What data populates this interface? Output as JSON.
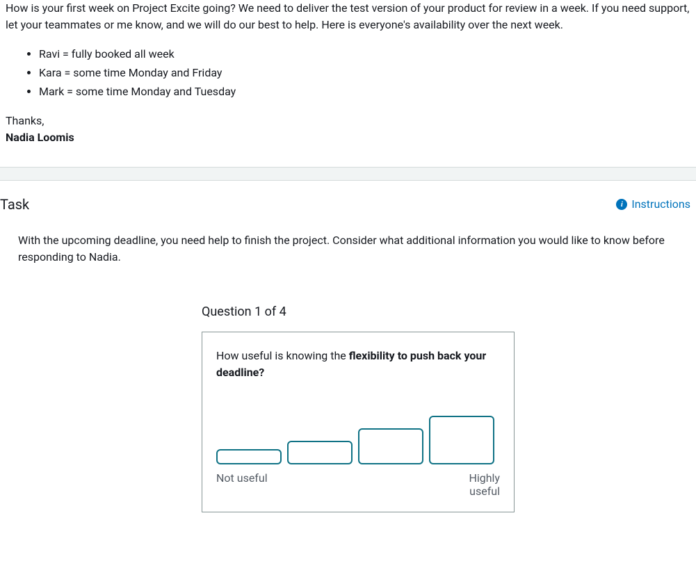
{
  "email": {
    "intro": "How is your first week on Project Excite going? We need to deliver the test version of your product for review in a week. If you need support, let your teammates or me know, and we will do our best to help. Here is everyone's availability over the next week.",
    "availability": [
      "Ravi = fully booked all week",
      "Kara = some time Monday and Friday",
      "Mark = some time Monday and Tuesday"
    ],
    "thanks": "Thanks,",
    "sender": "Nadia Loomis"
  },
  "task": {
    "title": "Task",
    "instructions_label": "Instructions",
    "prompt": "With the upcoming deadline, you need help to finish the project. Consider what additional information you would like to know before responding to Nadia."
  },
  "question": {
    "counter": "Question 1 of 4",
    "prefix": "How useful is knowing the ",
    "bold": "flexibility to push back your deadline?",
    "rating_low": "Not useful",
    "rating_high_1": "Highly",
    "rating_high_2": "useful"
  }
}
